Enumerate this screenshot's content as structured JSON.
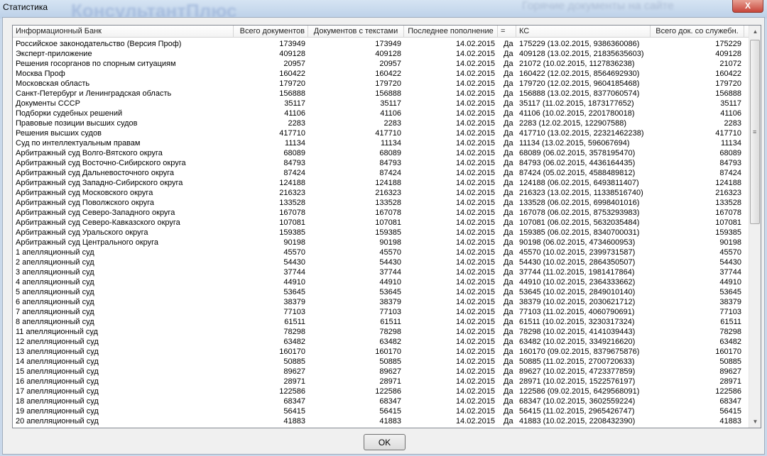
{
  "window": {
    "title": "Статистика",
    "bg_logo": "КонсультантПлюс",
    "bg_hot": "Горячие документы на сайте",
    "close_label": "X"
  },
  "columns": [
    "Информационный Банк",
    "Всего документов",
    "Документов с текстами",
    "Последнее пополнение",
    "=",
    "КС",
    "Всего док. со служебн."
  ],
  "rows": [
    [
      "Российское законодательство (Версия Проф)",
      "173949",
      "173949",
      "14.02.2015",
      "Да",
      "175229 (13.02.2015, 9386360086)",
      "175229"
    ],
    [
      "Эксперт-приложение",
      "409128",
      "409128",
      "14.02.2015",
      "Да",
      "409128 (13.02.2015, 21835635603)",
      "409128"
    ],
    [
      "Решения госорганов по спорным ситуациям",
      "20957",
      "20957",
      "14.02.2015",
      "Да",
      "21072 (10.02.2015, 1127836238)",
      "21072"
    ],
    [
      "Москва Проф",
      "160422",
      "160422",
      "14.02.2015",
      "Да",
      "160422 (12.02.2015, 8564692930)",
      "160422"
    ],
    [
      "Московская область",
      "179720",
      "179720",
      "14.02.2015",
      "Да",
      "179720 (12.02.2015, 9604185468)",
      "179720"
    ],
    [
      "Санкт-Петербург и Ленинградская область",
      "156888",
      "156888",
      "14.02.2015",
      "Да",
      "156888 (13.02.2015, 8377060574)",
      "156888"
    ],
    [
      "Документы СССР",
      "35117",
      "35117",
      "14.02.2015",
      "Да",
      "35117 (11.02.2015, 1873177652)",
      "35117"
    ],
    [
      "Подборки судебных решений",
      "41106",
      "41106",
      "14.02.2015",
      "Да",
      "41106 (10.02.2015, 2201780018)",
      "41106"
    ],
    [
      "Правовые позиции высших судов",
      "2283",
      "2283",
      "14.02.2015",
      "Да",
      "2283 (12.02.2015, 122907588)",
      "2283"
    ],
    [
      "Решения высших судов",
      "417710",
      "417710",
      "14.02.2015",
      "Да",
      "417710 (13.02.2015, 22321462238)",
      "417710"
    ],
    [
      "Суд по интеллектуальным правам",
      "11134",
      "11134",
      "14.02.2015",
      "Да",
      "11134 (13.02.2015, 596067694)",
      "11134"
    ],
    [
      "Арбитражный суд Волго-Вятского округа",
      "68089",
      "68089",
      "14.02.2015",
      "Да",
      "68089 (06.02.2015, 3578195470)",
      "68089"
    ],
    [
      "Арбитражный суд Восточно-Сибирского округа",
      "84793",
      "84793",
      "14.02.2015",
      "Да",
      "84793 (06.02.2015, 4436164435)",
      "84793"
    ],
    [
      "Арбитражный суд Дальневосточного округа",
      "87424",
      "87424",
      "14.02.2015",
      "Да",
      "87424 (05.02.2015, 4588489812)",
      "87424"
    ],
    [
      "Арбитражный суд Западно-Сибирского округа",
      "124188",
      "124188",
      "14.02.2015",
      "Да",
      "124188 (06.02.2015, 6493811407)",
      "124188"
    ],
    [
      "Арбитражный суд Московского округа",
      "216323",
      "216323",
      "14.02.2015",
      "Да",
      "216323 (13.02.2015, 11338516740)",
      "216323"
    ],
    [
      "Арбитражный суд Поволжского округа",
      "133528",
      "133528",
      "14.02.2015",
      "Да",
      "133528 (06.02.2015, 6998401016)",
      "133528"
    ],
    [
      "Арбитражный суд Северо-Западного округа",
      "167078",
      "167078",
      "14.02.2015",
      "Да",
      "167078 (06.02.2015, 8753293983)",
      "167078"
    ],
    [
      "Арбитражный суд Северо-Кавказского округа",
      "107081",
      "107081",
      "14.02.2015",
      "Да",
      "107081 (06.02.2015, 5632035484)",
      "107081"
    ],
    [
      "Арбитражный суд Уральского округа",
      "159385",
      "159385",
      "14.02.2015",
      "Да",
      "159385 (06.02.2015, 8340700031)",
      "159385"
    ],
    [
      "Арбитражный суд Центрального округа",
      "90198",
      "90198",
      "14.02.2015",
      "Да",
      "90198 (06.02.2015, 4734600953)",
      "90198"
    ],
    [
      "1 апелляционный суд",
      "45570",
      "45570",
      "14.02.2015",
      "Да",
      "45570 (10.02.2015, 2399731587)",
      "45570"
    ],
    [
      "2 апелляционный суд",
      "54430",
      "54430",
      "14.02.2015",
      "Да",
      "54430 (10.02.2015, 2864350507)",
      "54430"
    ],
    [
      "3 апелляционный суд",
      "37744",
      "37744",
      "14.02.2015",
      "Да",
      "37744 (11.02.2015, 1981417864)",
      "37744"
    ],
    [
      "4 апелляционный суд",
      "44910",
      "44910",
      "14.02.2015",
      "Да",
      "44910 (10.02.2015, 2364333662)",
      "44910"
    ],
    [
      "5 апелляционный суд",
      "53645",
      "53645",
      "14.02.2015",
      "Да",
      "53645 (10.02.2015, 2849010140)",
      "53645"
    ],
    [
      "6 апелляционный суд",
      "38379",
      "38379",
      "14.02.2015",
      "Да",
      "38379 (10.02.2015, 2030621712)",
      "38379"
    ],
    [
      "7 апелляционный суд",
      "77103",
      "77103",
      "14.02.2015",
      "Да",
      "77103 (11.02.2015, 4060790691)",
      "77103"
    ],
    [
      "8 апелляционный суд",
      "61511",
      "61511",
      "14.02.2015",
      "Да",
      "61511 (10.02.2015, 3230317324)",
      "61511"
    ],
    [
      "11 апелляционный суд",
      "78298",
      "78298",
      "14.02.2015",
      "Да",
      "78298 (10.02.2015, 4141039443)",
      "78298"
    ],
    [
      "12 апелляционный суд",
      "63482",
      "63482",
      "14.02.2015",
      "Да",
      "63482 (10.02.2015, 3349216620)",
      "63482"
    ],
    [
      "13 апелляционный суд",
      "160170",
      "160170",
      "14.02.2015",
      "Да",
      "160170 (09.02.2015, 8379675876)",
      "160170"
    ],
    [
      "14 апелляционный суд",
      "50885",
      "50885",
      "14.02.2015",
      "Да",
      "50885 (11.02.2015, 2700720633)",
      "50885"
    ],
    [
      "15 апелляционный суд",
      "89627",
      "89627",
      "14.02.2015",
      "Да",
      "89627 (10.02.2015, 4723377859)",
      "89627"
    ],
    [
      "16 апелляционный суд",
      "28971",
      "28971",
      "14.02.2015",
      "Да",
      "28971 (10.02.2015, 1522576197)",
      "28971"
    ],
    [
      "17 апелляционный суд",
      "122586",
      "122586",
      "14.02.2015",
      "Да",
      "122586 (09.02.2015, 6429568091)",
      "122586"
    ],
    [
      "18 апелляционный суд",
      "68347",
      "68347",
      "14.02.2015",
      "Да",
      "68347 (10.02.2015, 3602559224)",
      "68347"
    ],
    [
      "19 апелляционный суд",
      "56415",
      "56415",
      "14.02.2015",
      "Да",
      "56415 (11.02.2015, 2965426747)",
      "56415"
    ],
    [
      "20 апелляционный суд",
      "41883",
      "41883",
      "14.02.2015",
      "Да",
      "41883 (10.02.2015, 2208432390)",
      "41883"
    ]
  ],
  "ok_label": "OK"
}
